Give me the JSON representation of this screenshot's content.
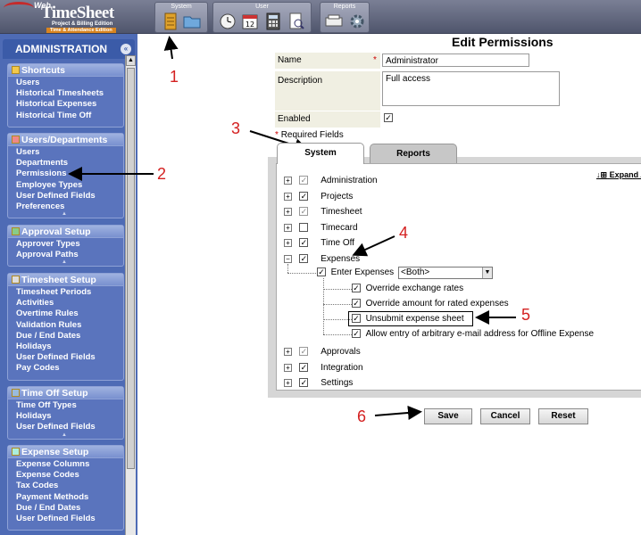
{
  "logo": {
    "web": "Web",
    "title": "TimeSheet",
    "edition1": "Project & Billing Edition",
    "edition2": "Time & Attendance Edition"
  },
  "toolbar": {
    "system_label": "System",
    "user_label": "User",
    "reports_label": "Reports"
  },
  "sidebar": {
    "title": "ADMINISTRATION",
    "panels": [
      {
        "title": "Shortcuts",
        "items": [
          "Users",
          "Historical Timesheets",
          "Historical Expenses",
          "Historical Time Off"
        ]
      },
      {
        "title": "Users/Departments",
        "items": [
          "Users",
          "Departments",
          "Permissions",
          "Employee Types",
          "User Defined Fields",
          "Preferences"
        ]
      },
      {
        "title": "Approval Setup",
        "items": [
          "Approver Types",
          "Approval Paths"
        ]
      },
      {
        "title": "Timesheet Setup",
        "items": [
          "Timesheet Periods",
          "Activities",
          "Overtime Rules",
          "Validation Rules",
          "Due / End Dates",
          "Holidays",
          "User Defined Fields",
          "Pay Codes"
        ]
      },
      {
        "title": "Time Off Setup",
        "items": [
          "Time Off Types",
          "Holidays",
          "User Defined Fields"
        ]
      },
      {
        "title": "Expense Setup",
        "items": [
          "Expense Columns",
          "Expense Codes",
          "Tax Codes",
          "Payment Methods",
          "Due / End Dates",
          "User Defined Fields"
        ]
      }
    ]
  },
  "main": {
    "title": "Edit Permissions",
    "form": {
      "name_label": "Name",
      "name_value": "Administrator",
      "description_label": "Description",
      "description_value": "Full access",
      "enabled_label": "Enabled",
      "required_star": "*",
      "required_note": "Required Fields"
    },
    "tabs": {
      "system": "System",
      "reports": "Reports"
    },
    "expand_label": "Expand A",
    "tree": {
      "administration": "Administration",
      "projects": "Projects",
      "timesheet": "Timesheet",
      "timecard": "Timecard",
      "time_off": "Time Off",
      "expenses": "Expenses",
      "enter_expenses": "Enter Expenses",
      "enter_expenses_select": "<Both>",
      "override_exchange": "Override exchange rates",
      "override_amount": "Override amount for rated expenses",
      "unsubmit": "Unsubmit expense sheet",
      "allow_entry": "Allow entry of arbitrary e-mail address for Offline Expense",
      "approvals": "Approvals",
      "integration": "Integration",
      "settings": "Settings"
    },
    "buttons": {
      "save": "Save",
      "cancel": "Cancel",
      "reset": "Reset"
    }
  },
  "annotations": {
    "n1": "1",
    "n2": "2",
    "n3": "3",
    "n4": "4",
    "n5": "5",
    "n6": "6"
  },
  "colors": {
    "sidebar": "#4e6bb5",
    "annotation": "#d42020"
  }
}
